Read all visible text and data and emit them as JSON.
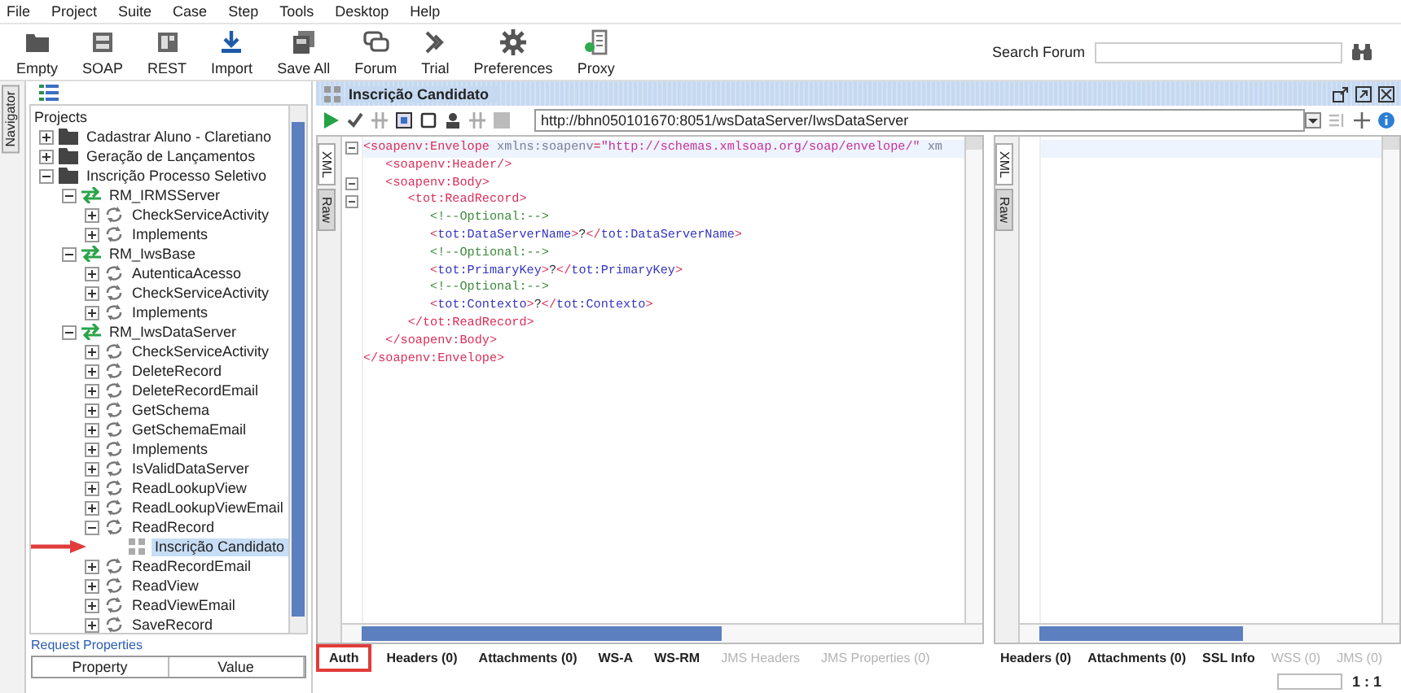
{
  "menu": [
    "File",
    "Project",
    "Suite",
    "Case",
    "Step",
    "Tools",
    "Desktop",
    "Help"
  ],
  "toolbar": [
    {
      "kind": "empty",
      "label": "Empty"
    },
    {
      "kind": "soap",
      "label": "SOAP"
    },
    {
      "kind": "rest",
      "label": "REST"
    },
    {
      "kind": "import",
      "label": "Import"
    },
    {
      "kind": "saveall",
      "label": "Save All"
    },
    {
      "kind": "forum",
      "label": "Forum"
    },
    {
      "kind": "trial",
      "label": "Trial"
    },
    {
      "kind": "preferences",
      "label": "Preferences"
    },
    {
      "kind": "proxy",
      "label": "Proxy"
    }
  ],
  "search": {
    "label": "Search Forum"
  },
  "navigator_tab": "Navigator",
  "tree": {
    "label": "Projects",
    "annotation": {
      "kind": "arrow"
    },
    "children": [
      {
        "kind": "project",
        "label": "Cadastrar Aluno - Claretiano",
        "expanded": false,
        "selected": false
      },
      {
        "kind": "project",
        "label": "Geração de Lançamentos",
        "expanded": false,
        "selected": false
      },
      {
        "kind": "project",
        "label": "Inscrição Processo Seletivo",
        "expanded": true,
        "selected": false,
        "children": [
          {
            "kind": "interface",
            "label": "RM_IRMSServer",
            "expanded": true,
            "selected": false,
            "children": [
              {
                "kind": "operation",
                "label": "CheckServiceActivity",
                "expanded": false,
                "selected": false
              },
              {
                "kind": "operation",
                "label": "Implements",
                "expanded": false,
                "selected": false
              }
            ]
          },
          {
            "kind": "interface",
            "label": "RM_IwsBase",
            "expanded": true,
            "selected": false,
            "children": [
              {
                "kind": "operation",
                "label": "AutenticaAcesso",
                "expanded": false,
                "selected": false
              },
              {
                "kind": "operation",
                "label": "CheckServiceActivity",
                "expanded": false,
                "selected": false
              },
              {
                "kind": "operation",
                "label": "Implements",
                "expanded": false,
                "selected": false
              }
            ]
          },
          {
            "kind": "interface",
            "label": "RM_IwsDataServer",
            "expanded": true,
            "selected": false,
            "children": [
              {
                "kind": "operation",
                "label": "CheckServiceActivity",
                "expanded": false,
                "selected": false
              },
              {
                "kind": "operation",
                "label": "DeleteRecord",
                "expanded": false,
                "selected": false
              },
              {
                "kind": "operation",
                "label": "DeleteRecordEmail",
                "expanded": false,
                "selected": false
              },
              {
                "kind": "operation",
                "label": "GetSchema",
                "expanded": false,
                "selected": false
              },
              {
                "kind": "operation",
                "label": "GetSchemaEmail",
                "expanded": false,
                "selected": false
              },
              {
                "kind": "operation",
                "label": "Implements",
                "expanded": false,
                "selected": false
              },
              {
                "kind": "operation",
                "label": "IsValidDataServer",
                "expanded": false,
                "selected": false
              },
              {
                "kind": "operation",
                "label": "ReadLookupView",
                "expanded": false,
                "selected": false
              },
              {
                "kind": "operation",
                "label": "ReadLookupViewEmail",
                "expanded": false,
                "selected": false
              },
              {
                "kind": "operation",
                "label": "ReadRecord",
                "expanded": true,
                "selected": false,
                "children": [
                  {
                    "kind": "request",
                    "label": "Inscrição Candidato",
                    "selected": true
                  }
                ]
              },
              {
                "kind": "operation",
                "label": "ReadRecordEmail",
                "expanded": false,
                "selected": false
              },
              {
                "kind": "operation",
                "label": "ReadView",
                "expanded": false,
                "selected": false
              },
              {
                "kind": "operation",
                "label": "ReadViewEmail",
                "expanded": false,
                "selected": false
              },
              {
                "kind": "operation",
                "label": "SaveRecord",
                "expanded": false,
                "selected": false
              }
            ]
          }
        ]
      }
    ]
  },
  "properties": {
    "title": "Request Properties",
    "columns": [
      "Property",
      "Value"
    ]
  },
  "editor": {
    "title": "Inscrição Candidato",
    "url": "http://bhn050101670:8051/wsDataServer/IwsDataServer",
    "request_views": [
      {
        "label": "XML",
        "selected": true
      },
      {
        "label": "Raw",
        "selected": false
      }
    ],
    "response_views": [
      {
        "label": "XML",
        "selected": true
      },
      {
        "label": "Raw",
        "selected": false
      }
    ],
    "code": [
      {
        "fold": true,
        "tokens": [
          {
            "kind": "tag",
            "text": "<soapenv:Envelope"
          },
          {
            "kind": "attr",
            "text": " xmlns:soapenv"
          },
          {
            "kind": "tag",
            "text": "="
          },
          {
            "kind": "value",
            "text": "\"http://schemas.xmlsoap.org/soap/envelope/\""
          },
          {
            "kind": "attr",
            "text": " xm"
          }
        ]
      },
      {
        "fold": false,
        "tokens": [
          {
            "kind": "tag",
            "text": "   <soapenv:Header/>"
          }
        ]
      },
      {
        "fold": true,
        "tokens": [
          {
            "kind": "tag",
            "text": "   <soapenv:Body>"
          }
        ]
      },
      {
        "fold": true,
        "tokens": [
          {
            "kind": "tag",
            "text": "      <tot:ReadRecord>"
          }
        ]
      },
      {
        "fold": false,
        "tokens": [
          {
            "kind": "comment",
            "text": "         <!--Optional:-->"
          }
        ]
      },
      {
        "fold": false,
        "tokens": [
          {
            "kind": "tag",
            "text": "         <"
          },
          {
            "kind": "element",
            "text": "tot:DataServerName"
          },
          {
            "kind": "tag",
            "text": ">"
          },
          {
            "kind": "text",
            "text": "?"
          },
          {
            "kind": "tag",
            "text": "</"
          },
          {
            "kind": "element",
            "text": "tot:DataServerName"
          },
          {
            "kind": "tag",
            "text": ">"
          }
        ]
      },
      {
        "fold": false,
        "tokens": [
          {
            "kind": "comment",
            "text": "         <!--Optional:-->"
          }
        ]
      },
      {
        "fold": false,
        "tokens": [
          {
            "kind": "tag",
            "text": "         <"
          },
          {
            "kind": "element",
            "text": "tot:PrimaryKey"
          },
          {
            "kind": "tag",
            "text": ">"
          },
          {
            "kind": "text",
            "text": "?"
          },
          {
            "kind": "tag",
            "text": "</"
          },
          {
            "kind": "element",
            "text": "tot:PrimaryKey"
          },
          {
            "kind": "tag",
            "text": ">"
          }
        ]
      },
      {
        "fold": false,
        "tokens": [
          {
            "kind": "comment",
            "text": "         <!--Optional:-->"
          }
        ]
      },
      {
        "fold": false,
        "tokens": [
          {
            "kind": "tag",
            "text": "         <"
          },
          {
            "kind": "element",
            "text": "tot:Contexto"
          },
          {
            "kind": "tag",
            "text": ">"
          },
          {
            "kind": "text",
            "text": "?"
          },
          {
            "kind": "tag",
            "text": "</"
          },
          {
            "kind": "element",
            "text": "tot:Contexto"
          },
          {
            "kind": "tag",
            "text": ">"
          }
        ]
      },
      {
        "fold": false,
        "tokens": [
          {
            "kind": "tag",
            "text": "      </tot:ReadRecord>"
          }
        ]
      },
      {
        "fold": false,
        "tokens": [
          {
            "kind": "tag",
            "text": "   </soapenv:Body>"
          }
        ]
      },
      {
        "fold": false,
        "tokens": [
          {
            "kind": "tag",
            "text": "</soapenv:Envelope>"
          }
        ]
      }
    ],
    "request_tabs": [
      {
        "label": "Auth",
        "disabled": false,
        "highlighted": true
      },
      {
        "label": "Headers (0)",
        "disabled": false,
        "highlighted": false
      },
      {
        "label": "Attachments (0)",
        "disabled": false,
        "highlighted": false
      },
      {
        "label": "WS-A",
        "disabled": false,
        "highlighted": false
      },
      {
        "label": "WS-RM",
        "disabled": false,
        "highlighted": false
      },
      {
        "label": "JMS Headers",
        "disabled": true,
        "highlighted": false
      },
      {
        "label": "JMS Properties (0)",
        "disabled": true,
        "highlighted": false
      }
    ],
    "response_tabs": [
      {
        "label": "Headers (0)",
        "disabled": false
      },
      {
        "label": "Attachments (0)",
        "disabled": false
      },
      {
        "label": "SSL Info",
        "disabled": false
      },
      {
        "label": "WSS (0)",
        "disabled": true
      },
      {
        "label": "JMS (0)",
        "disabled": true
      }
    ],
    "position": "1 : 1"
  }
}
